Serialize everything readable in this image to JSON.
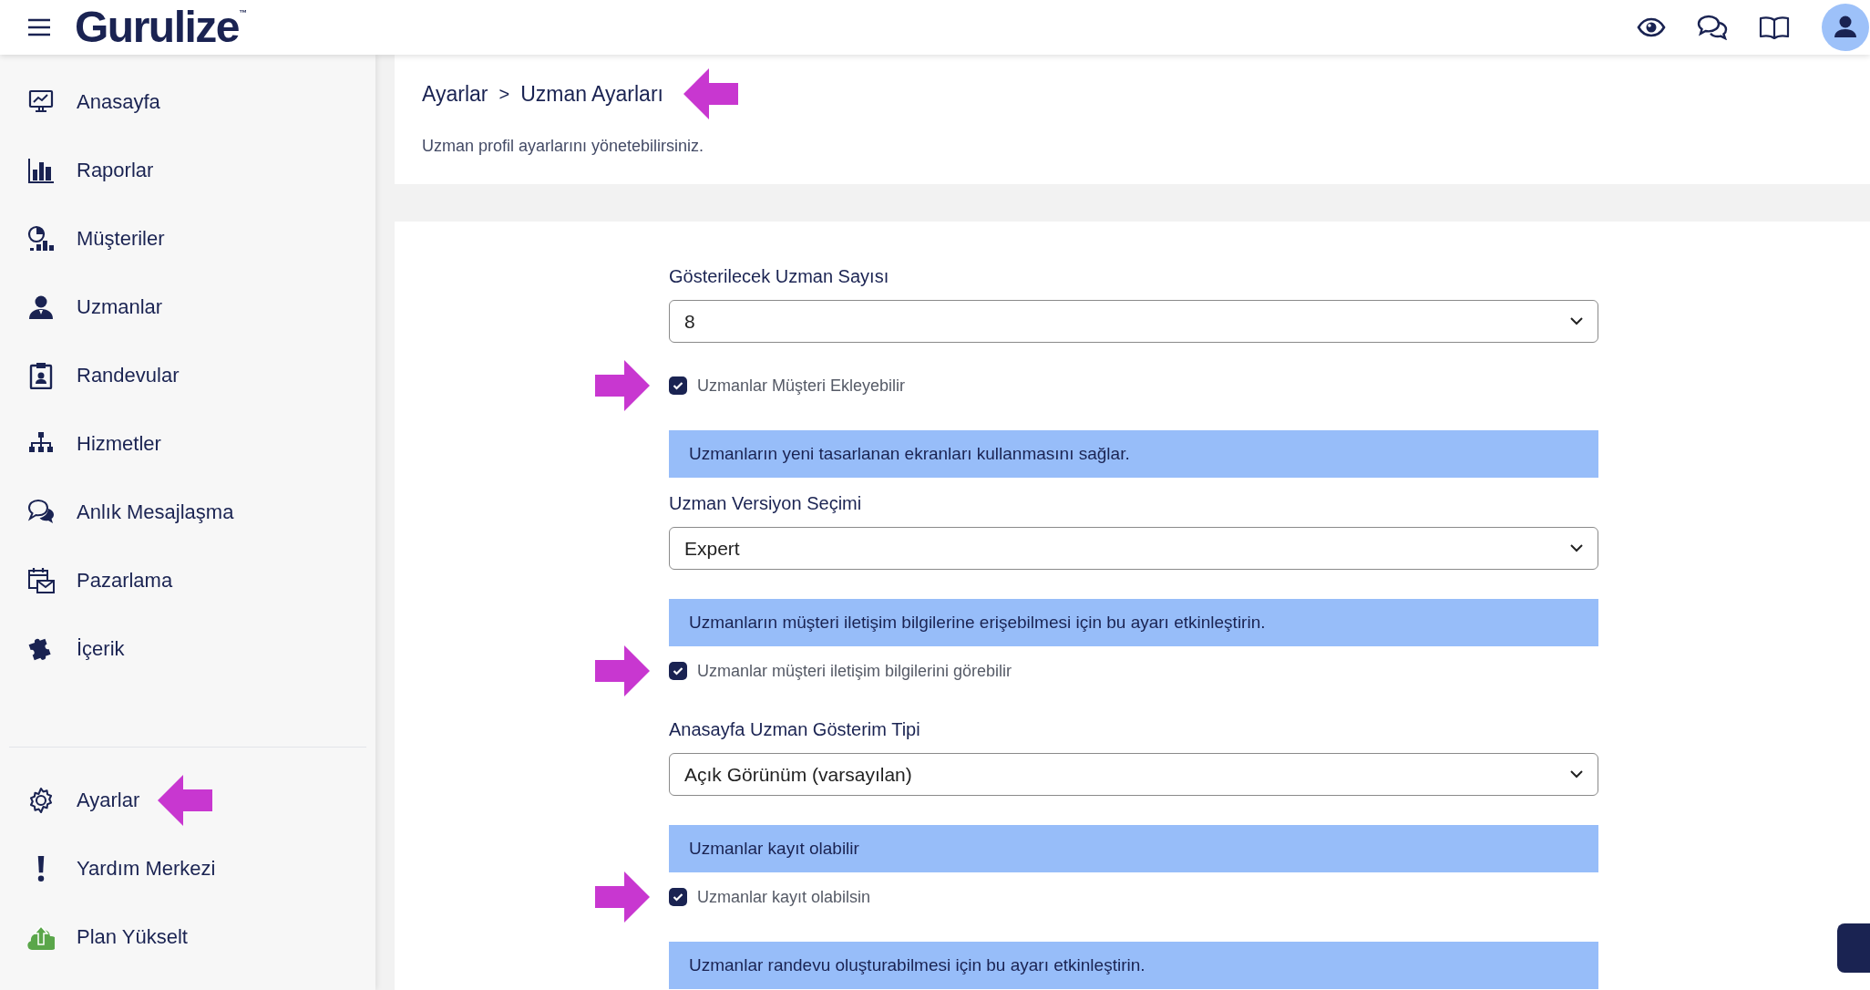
{
  "header": {
    "logo": "Gurulize",
    "trademark": "™"
  },
  "sidebar": {
    "items": [
      {
        "label": "Anasayfa"
      },
      {
        "label": "Raporlar"
      },
      {
        "label": "Müşteriler"
      },
      {
        "label": "Uzmanlar"
      },
      {
        "label": "Randevular"
      },
      {
        "label": "Hizmetler"
      },
      {
        "label": "Anlık Mesajlaşma"
      },
      {
        "label": "Pazarlama"
      },
      {
        "label": "İçerik"
      }
    ],
    "bottom_items": [
      {
        "label": "Ayarlar"
      },
      {
        "label": "Yardım Merkezi"
      },
      {
        "label": "Plan Yükselt"
      }
    ]
  },
  "page_header": {
    "breadcrumb": [
      "Ayarlar",
      "Uzman Ayarları"
    ],
    "separator": ">",
    "description": "Uzman profil ayarlarını yönetebilirsiniz."
  },
  "form": [
    {
      "kind": "select",
      "label": "Gösterilecek Uzman Sayısı",
      "value": "8"
    },
    {
      "kind": "checkbox",
      "label": "Uzmanlar Müşteri Ekleyebilir",
      "checked": true
    },
    {
      "kind": "notice",
      "text": "Uzmanların yeni tasarlanan ekranları kullanmasını sağlar."
    },
    {
      "kind": "select",
      "label": "Uzman Versiyon Seçimi",
      "value": "Expert"
    },
    {
      "kind": "notice",
      "text": "Uzmanların müşteri iletişim bilgilerine erişebilmesi için bu ayarı etkinleştirin."
    },
    {
      "kind": "checkbox",
      "label": "Uzmanlar müşteri iletişim bilgilerini görebilir",
      "checked": true
    },
    {
      "kind": "select",
      "label": "Anasayfa Uzman Gösterim Tipi",
      "value": "Açık Görünüm (varsayılan)"
    },
    {
      "kind": "notice",
      "text": "Uzmanlar kayıt olabilir"
    },
    {
      "kind": "checkbox",
      "label": "Uzmanlar kayıt olabilsin",
      "checked": true
    },
    {
      "kind": "notice",
      "text": "Uzmanlar randevu oluşturabilmesi için bu ayarı etkinleştirin."
    }
  ]
}
